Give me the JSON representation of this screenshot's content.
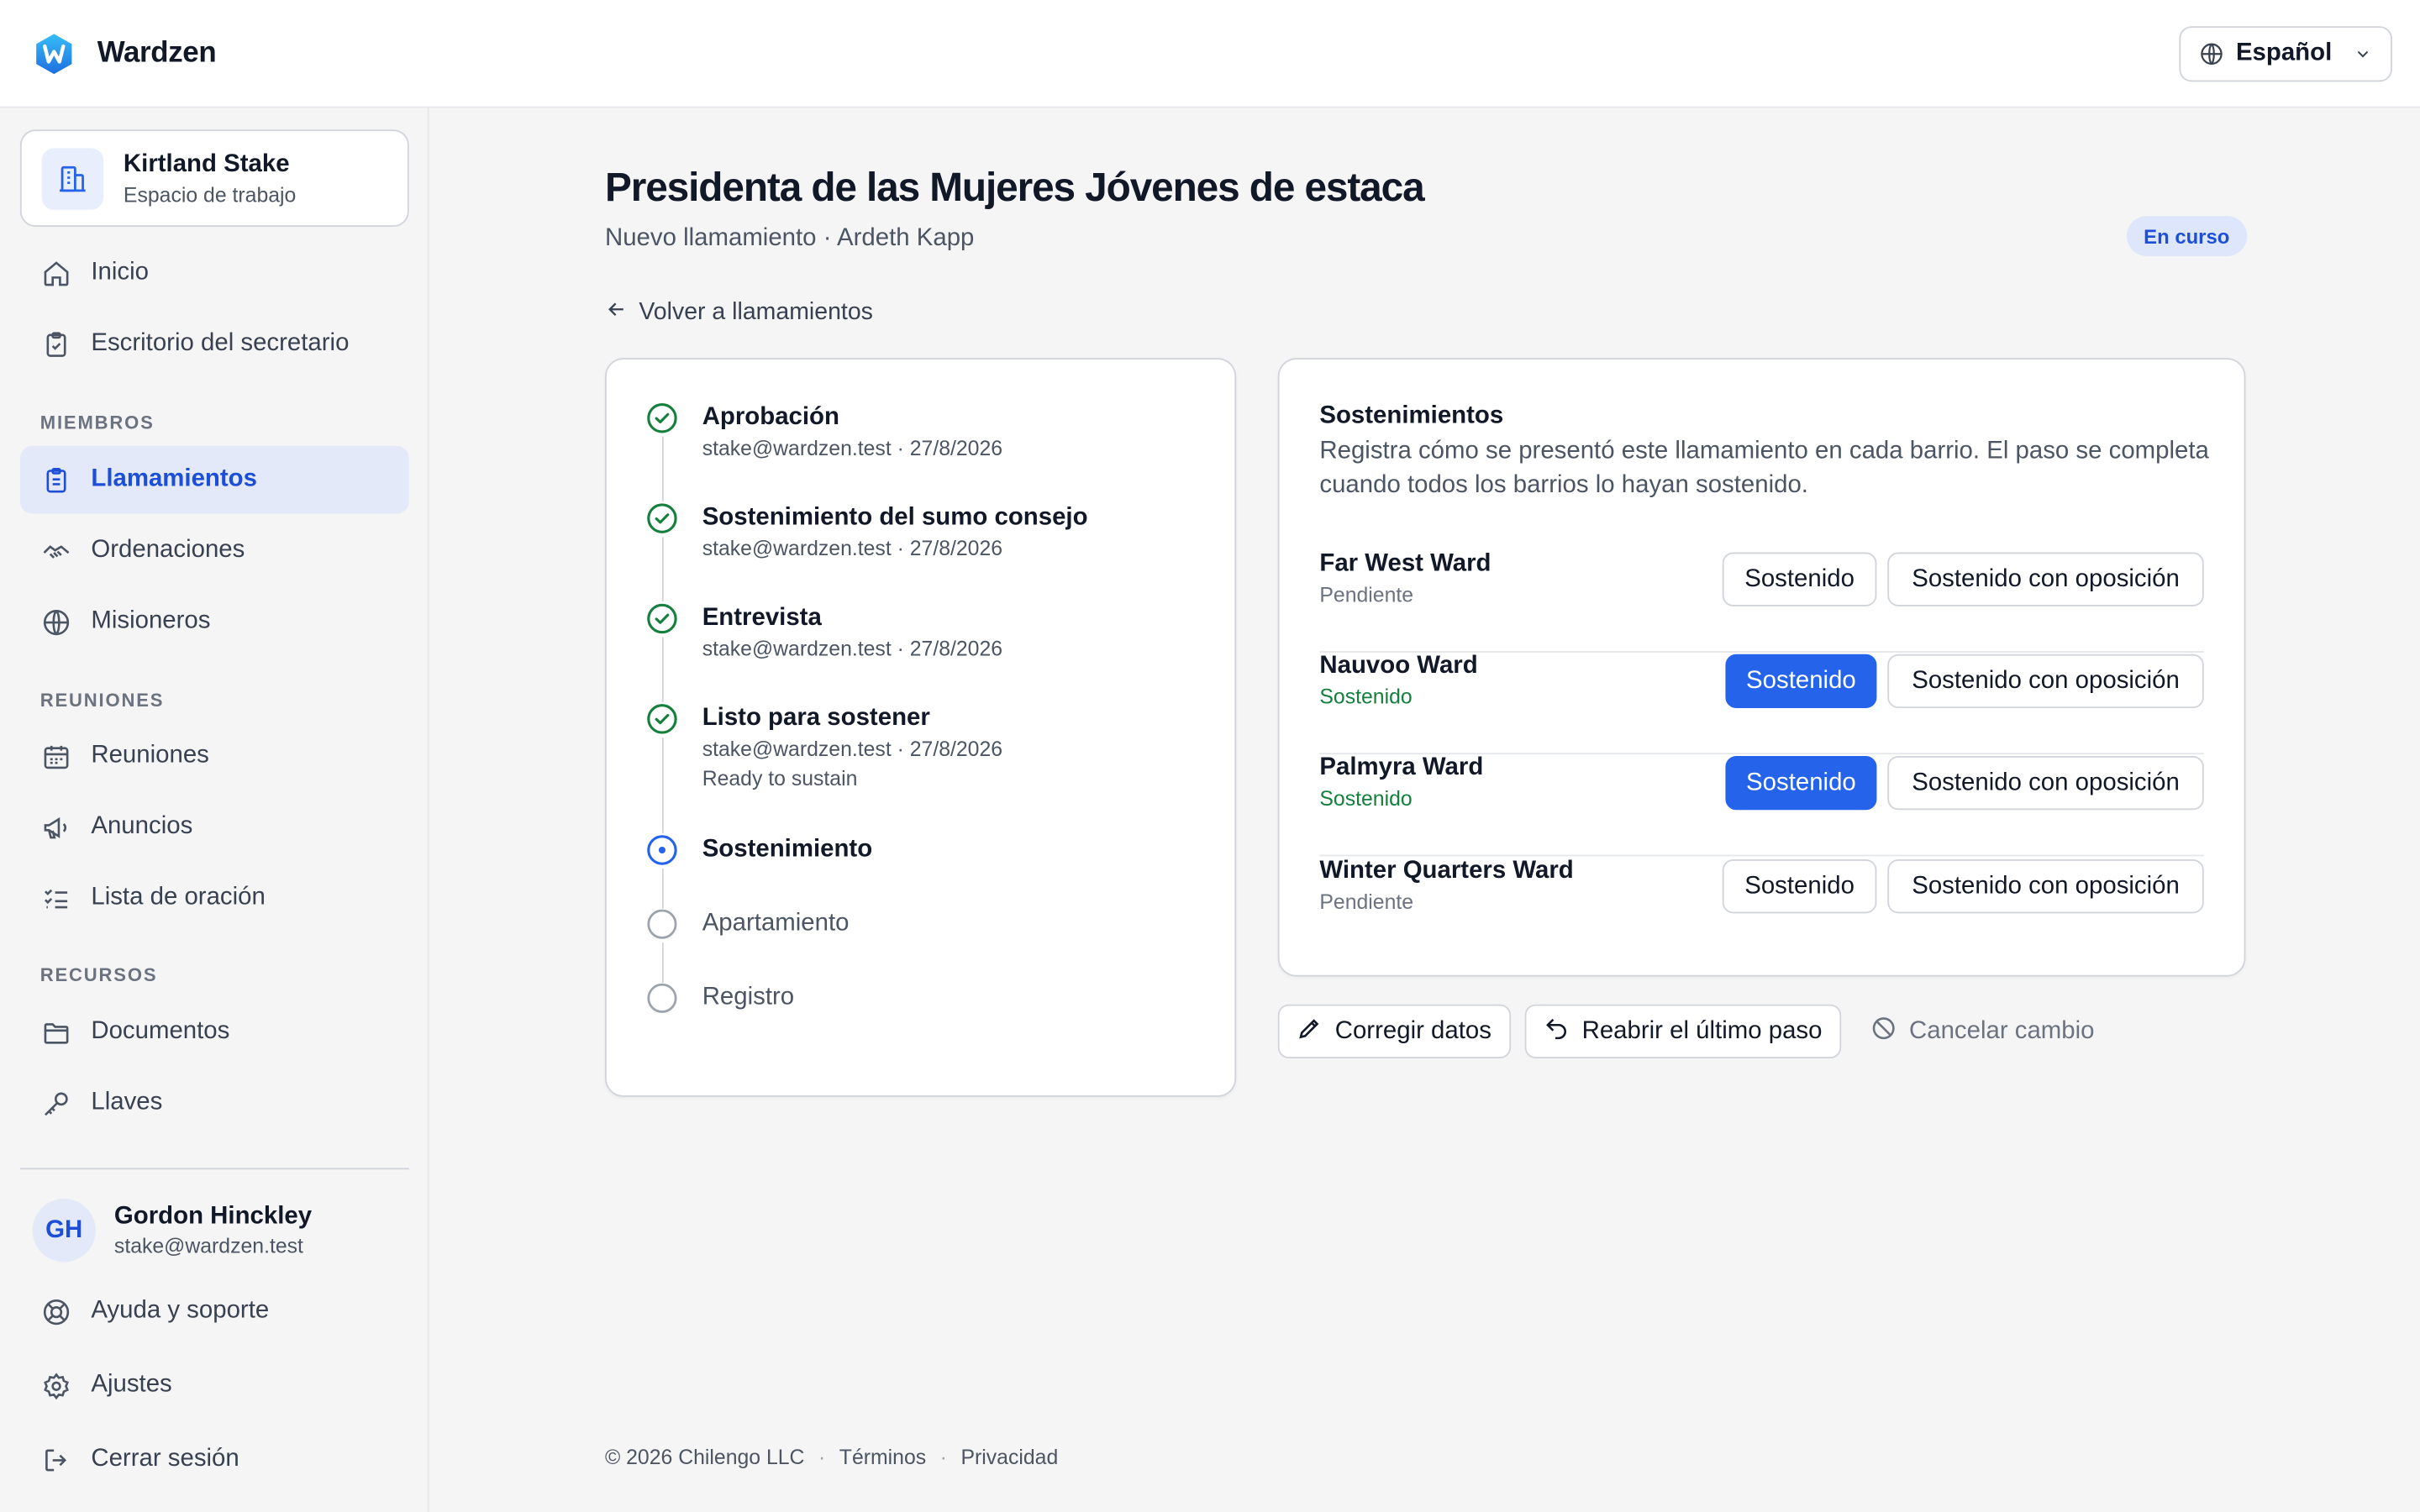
{
  "header": {
    "brand": "Wardzen",
    "language": "Español"
  },
  "workspace": {
    "name": "Kirtland Stake",
    "subtitle": "Espacio de trabajo"
  },
  "sidebar": {
    "top_items": [
      {
        "label": "Inicio",
        "icon": "home-icon"
      },
      {
        "label": "Escritorio del secretario",
        "icon": "clipboard-icon"
      }
    ],
    "sections": [
      {
        "title": "MIEMBROS",
        "items": [
          {
            "label": "Llamamientos",
            "icon": "clipboard-list-icon",
            "active": true
          },
          {
            "label": "Ordenaciones",
            "icon": "handshake-icon"
          },
          {
            "label": "Misioneros",
            "icon": "globe-icon"
          }
        ]
      },
      {
        "title": "REUNIONES",
        "items": [
          {
            "label": "Reuniones",
            "icon": "calendar-icon"
          },
          {
            "label": "Anuncios",
            "icon": "megaphone-icon"
          },
          {
            "label": "Lista de oración",
            "icon": "checklist-icon"
          }
        ]
      },
      {
        "title": "RECURSOS",
        "items": [
          {
            "label": "Documentos",
            "icon": "folder-icon"
          },
          {
            "label": "Llaves",
            "icon": "key-icon"
          }
        ]
      }
    ],
    "user": {
      "initials": "GH",
      "name": "Gordon Hinckley",
      "email": "stake@wardzen.test"
    },
    "bottom_items": [
      {
        "label": "Ayuda y soporte",
        "icon": "lifebuoy-icon"
      },
      {
        "label": "Ajustes",
        "icon": "gear-icon"
      },
      {
        "label": "Cerrar sesión",
        "icon": "logout-icon"
      }
    ]
  },
  "page": {
    "title": "Presidenta de las Mujeres Jóvenes de estaca",
    "subtitle": "Nuevo llamamiento · Ardeth Kapp",
    "status": "En curso",
    "back_label": "Volver a llamamientos"
  },
  "steps": [
    {
      "name": "Aprobación",
      "meta": "stake@wardzen.test · 27/8/2026",
      "state": "done"
    },
    {
      "name": "Sostenimiento del sumo consejo",
      "meta": "stake@wardzen.test · 27/8/2026",
      "state": "done"
    },
    {
      "name": "Entrevista",
      "meta": "stake@wardzen.test · 27/8/2026",
      "state": "done"
    },
    {
      "name": "Listo para sostener",
      "meta": "stake@wardzen.test · 27/8/2026",
      "note": "Ready to sustain",
      "state": "done"
    },
    {
      "name": "Sostenimiento",
      "state": "current"
    },
    {
      "name": "Apartamiento",
      "state": "pending"
    },
    {
      "name": "Registro",
      "state": "pending"
    }
  ],
  "sustainings": {
    "title": "Sostenimientos",
    "description": "Registra cómo se presentó este llamamiento en cada barrio. El paso se completa cuando todos los barrios lo hayan sostenido.",
    "sustained_label": "Sostenido",
    "opposed_label": "Sostenido con oposición",
    "wards": [
      {
        "name": "Far West Ward",
        "status": "Pendiente",
        "sustained": false
      },
      {
        "name": "Nauvoo Ward",
        "status": "Sostenido",
        "sustained": true
      },
      {
        "name": "Palmyra Ward",
        "status": "Sostenido",
        "sustained": true
      },
      {
        "name": "Winter Quarters Ward",
        "status": "Pendiente",
        "sustained": false
      }
    ]
  },
  "actions": {
    "edit": "Corregir datos",
    "reopen": "Reabrir el último paso",
    "cancel": "Cancelar cambio"
  },
  "footer": {
    "copyright": "© 2026 Chilengo LLC",
    "terms": "Términos",
    "privacy": "Privacidad"
  },
  "colors": {
    "accent": "#2563eb",
    "success": "#15803d",
    "brand": "#1d9bf0"
  }
}
